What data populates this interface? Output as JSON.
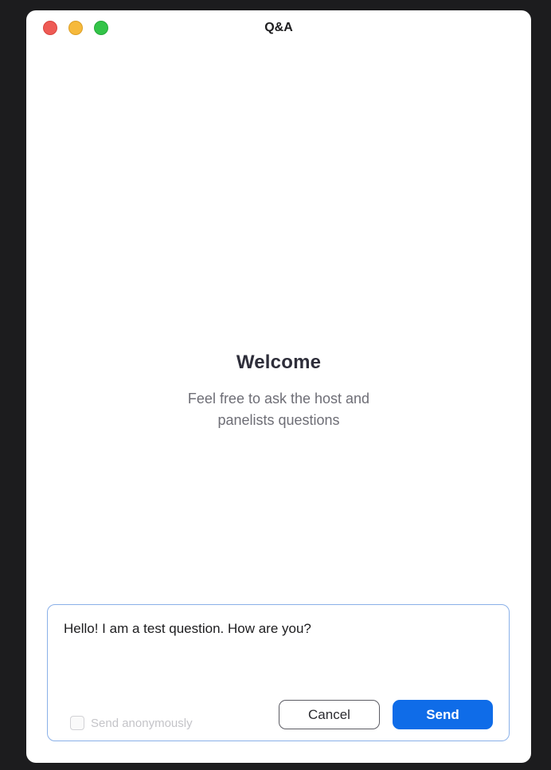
{
  "window": {
    "title": "Q&A"
  },
  "welcome": {
    "heading": "Welcome",
    "text": "Feel free to ask the host and panelists questions"
  },
  "composer": {
    "question_value": "Hello! I am a test question. How are you?",
    "anonymous_label": "Send anonymously",
    "anonymous_checked": false,
    "cancel_label": "Cancel",
    "send_label": "Send"
  },
  "colors": {
    "accent": "#0f6ce8",
    "close": "#ee5b55",
    "minimize": "#f6b93b",
    "zoom": "#33c448"
  }
}
